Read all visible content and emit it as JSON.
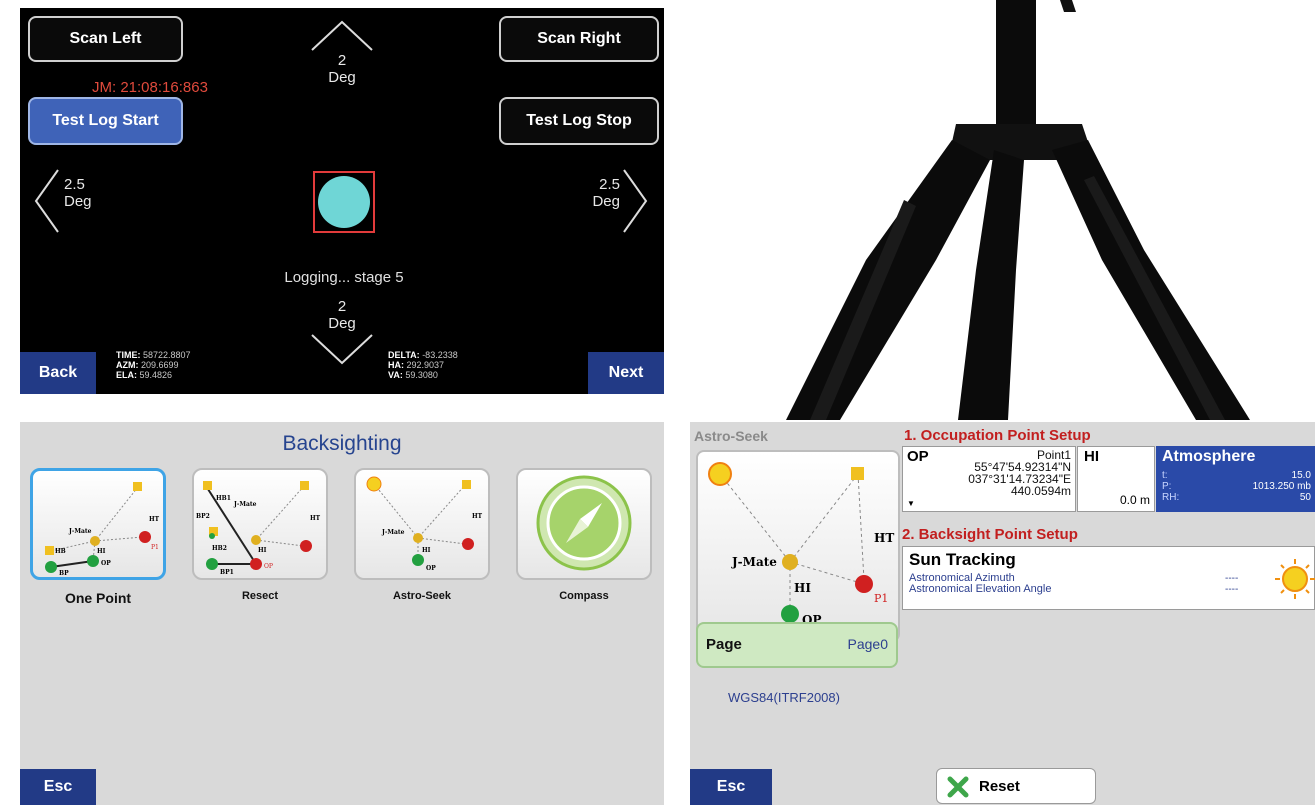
{
  "scan_screen": {
    "scan_left_label": "Scan Left",
    "scan_right_label": "Scan Right",
    "test_log_start_label": "Test Log Start",
    "test_log_stop_label": "Test Log Stop",
    "timestamp": "JM: 21:08:16:863",
    "up": {
      "value": "2",
      "unit": "Deg"
    },
    "down": {
      "value": "2",
      "unit": "Deg"
    },
    "left": {
      "value": "2.5",
      "unit": "Deg"
    },
    "right": {
      "value": "2.5",
      "unit": "Deg"
    },
    "status": "Logging... stage 5",
    "back_label": "Back",
    "next_label": "Next",
    "stats_left": {
      "time_label": "TIME:",
      "time_value": "58722.8807",
      "azm_label": "AZM:",
      "azm_value": "209.6699",
      "ela_label": "ELA:",
      "ela_value": "59.4826"
    },
    "stats_right": {
      "delta_label": "DELTA:",
      "delta_value": "-83.2338",
      "ha_label": "HA:",
      "ha_value": "292.9037",
      "va_label": "VA:",
      "va_value": "59.3080"
    },
    "colors": {
      "target_fill": "#6fd6d6",
      "target_border": "#e23b3b",
      "timestamp": "#e04a3c",
      "accent_button": "#3f63b8"
    }
  },
  "backsighting": {
    "title": "Backsighting",
    "options": [
      {
        "label": "One Point",
        "selected": true
      },
      {
        "label": "Resect",
        "selected": false
      },
      {
        "label": "Astro-Seek",
        "selected": false
      },
      {
        "label": "Compass",
        "selected": false
      }
    ],
    "diagram_labels": {
      "jmate": "J-Mate",
      "hi": "HI",
      "ht": "HT",
      "hb": "HB",
      "bp": "BP",
      "op": "OP",
      "p1": "P1",
      "hb1": "HB1",
      "hb2": "HB2",
      "bp1": "BP1",
      "bp2": "BP2"
    },
    "esc_label": "Esc"
  },
  "astro_seek": {
    "header": "Astro-Seek",
    "section1_title": "1. Occupation Point Setup",
    "op": {
      "label": "OP",
      "point": "Point1",
      "lat": "55°47'54.92314\"N",
      "lon": "037°31'14.73234\"E",
      "height": "440.0594m"
    },
    "hi": {
      "label": "HI",
      "value": "0.0 m"
    },
    "atmosphere": {
      "title": "Atmosphere",
      "t_label": "t:",
      "t_value": "15.0",
      "p_label": "P:",
      "p_value": "1013.250 mb",
      "rh_label": "RH:",
      "rh_value": "50"
    },
    "section2_title": "2. Backsight Point Setup",
    "sun_tracking": {
      "title": "Sun Tracking",
      "azimuth_label": "Astronomical Azimuth",
      "azimuth_value": "----",
      "elevation_label": "Astronomical Elevation Angle",
      "elevation_value": "----"
    },
    "page": {
      "label": "Page",
      "value": "Page0"
    },
    "datum": "WGS84(ITRF2008)",
    "esc_label": "Esc",
    "reset_label": "Reset"
  }
}
